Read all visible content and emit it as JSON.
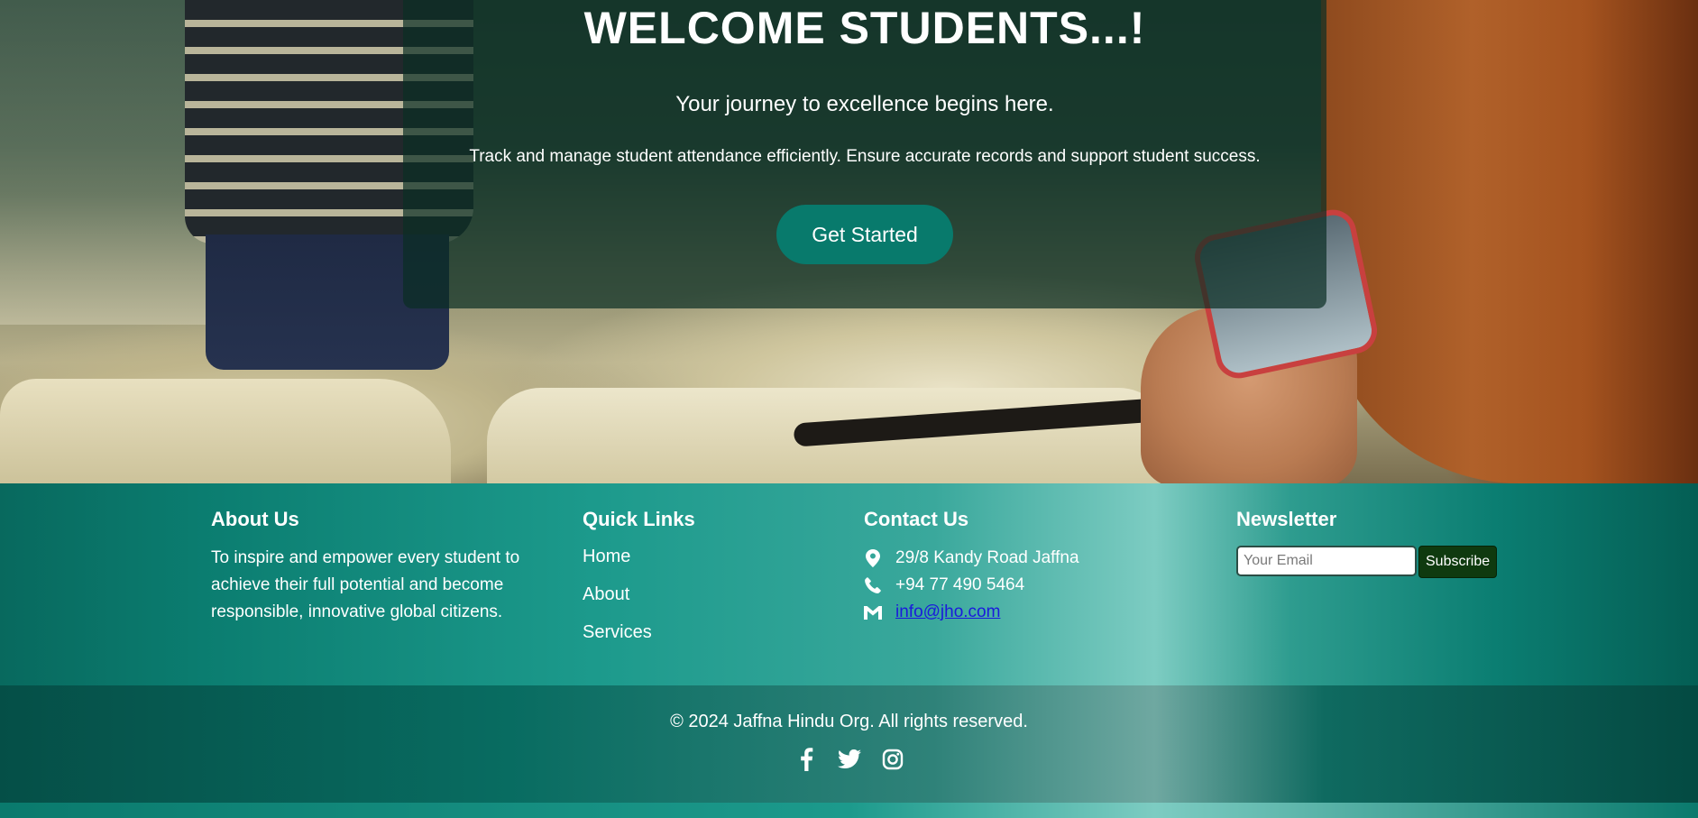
{
  "hero": {
    "title": "WELCOME STUDENTS...!",
    "subtitle": "Your journey to excellence begins here.",
    "description": "Track and manage student attendance efficiently. Ensure accurate records and support student success.",
    "cta_label": "Get Started"
  },
  "footer": {
    "about": {
      "heading": "About Us",
      "text": "To inspire and empower every student to achieve their full potential and become responsible, innovative global citizens."
    },
    "quick_links": {
      "heading": "Quick Links",
      "items": [
        {
          "label": "Home"
        },
        {
          "label": "About"
        },
        {
          "label": "Services"
        }
      ]
    },
    "contact": {
      "heading": "Contact Us",
      "address": "29/8 Kandy Road Jaffna",
      "phone": "+94 77 490 5464",
      "email": "info@jho.com"
    },
    "newsletter": {
      "heading": "Newsletter",
      "placeholder": "Your Email",
      "value": "",
      "button_label": "Subscribe"
    },
    "copyright": "© 2024 Jaffna Hindu Org. All rights reserved.",
    "social": [
      {
        "icon": "facebook-icon"
      },
      {
        "icon": "twitter-icon"
      },
      {
        "icon": "instagram-icon"
      }
    ]
  },
  "colors": {
    "accent": "#087a6c",
    "subscribe_button": "#0f3a0f",
    "link": "#1a1adc"
  }
}
